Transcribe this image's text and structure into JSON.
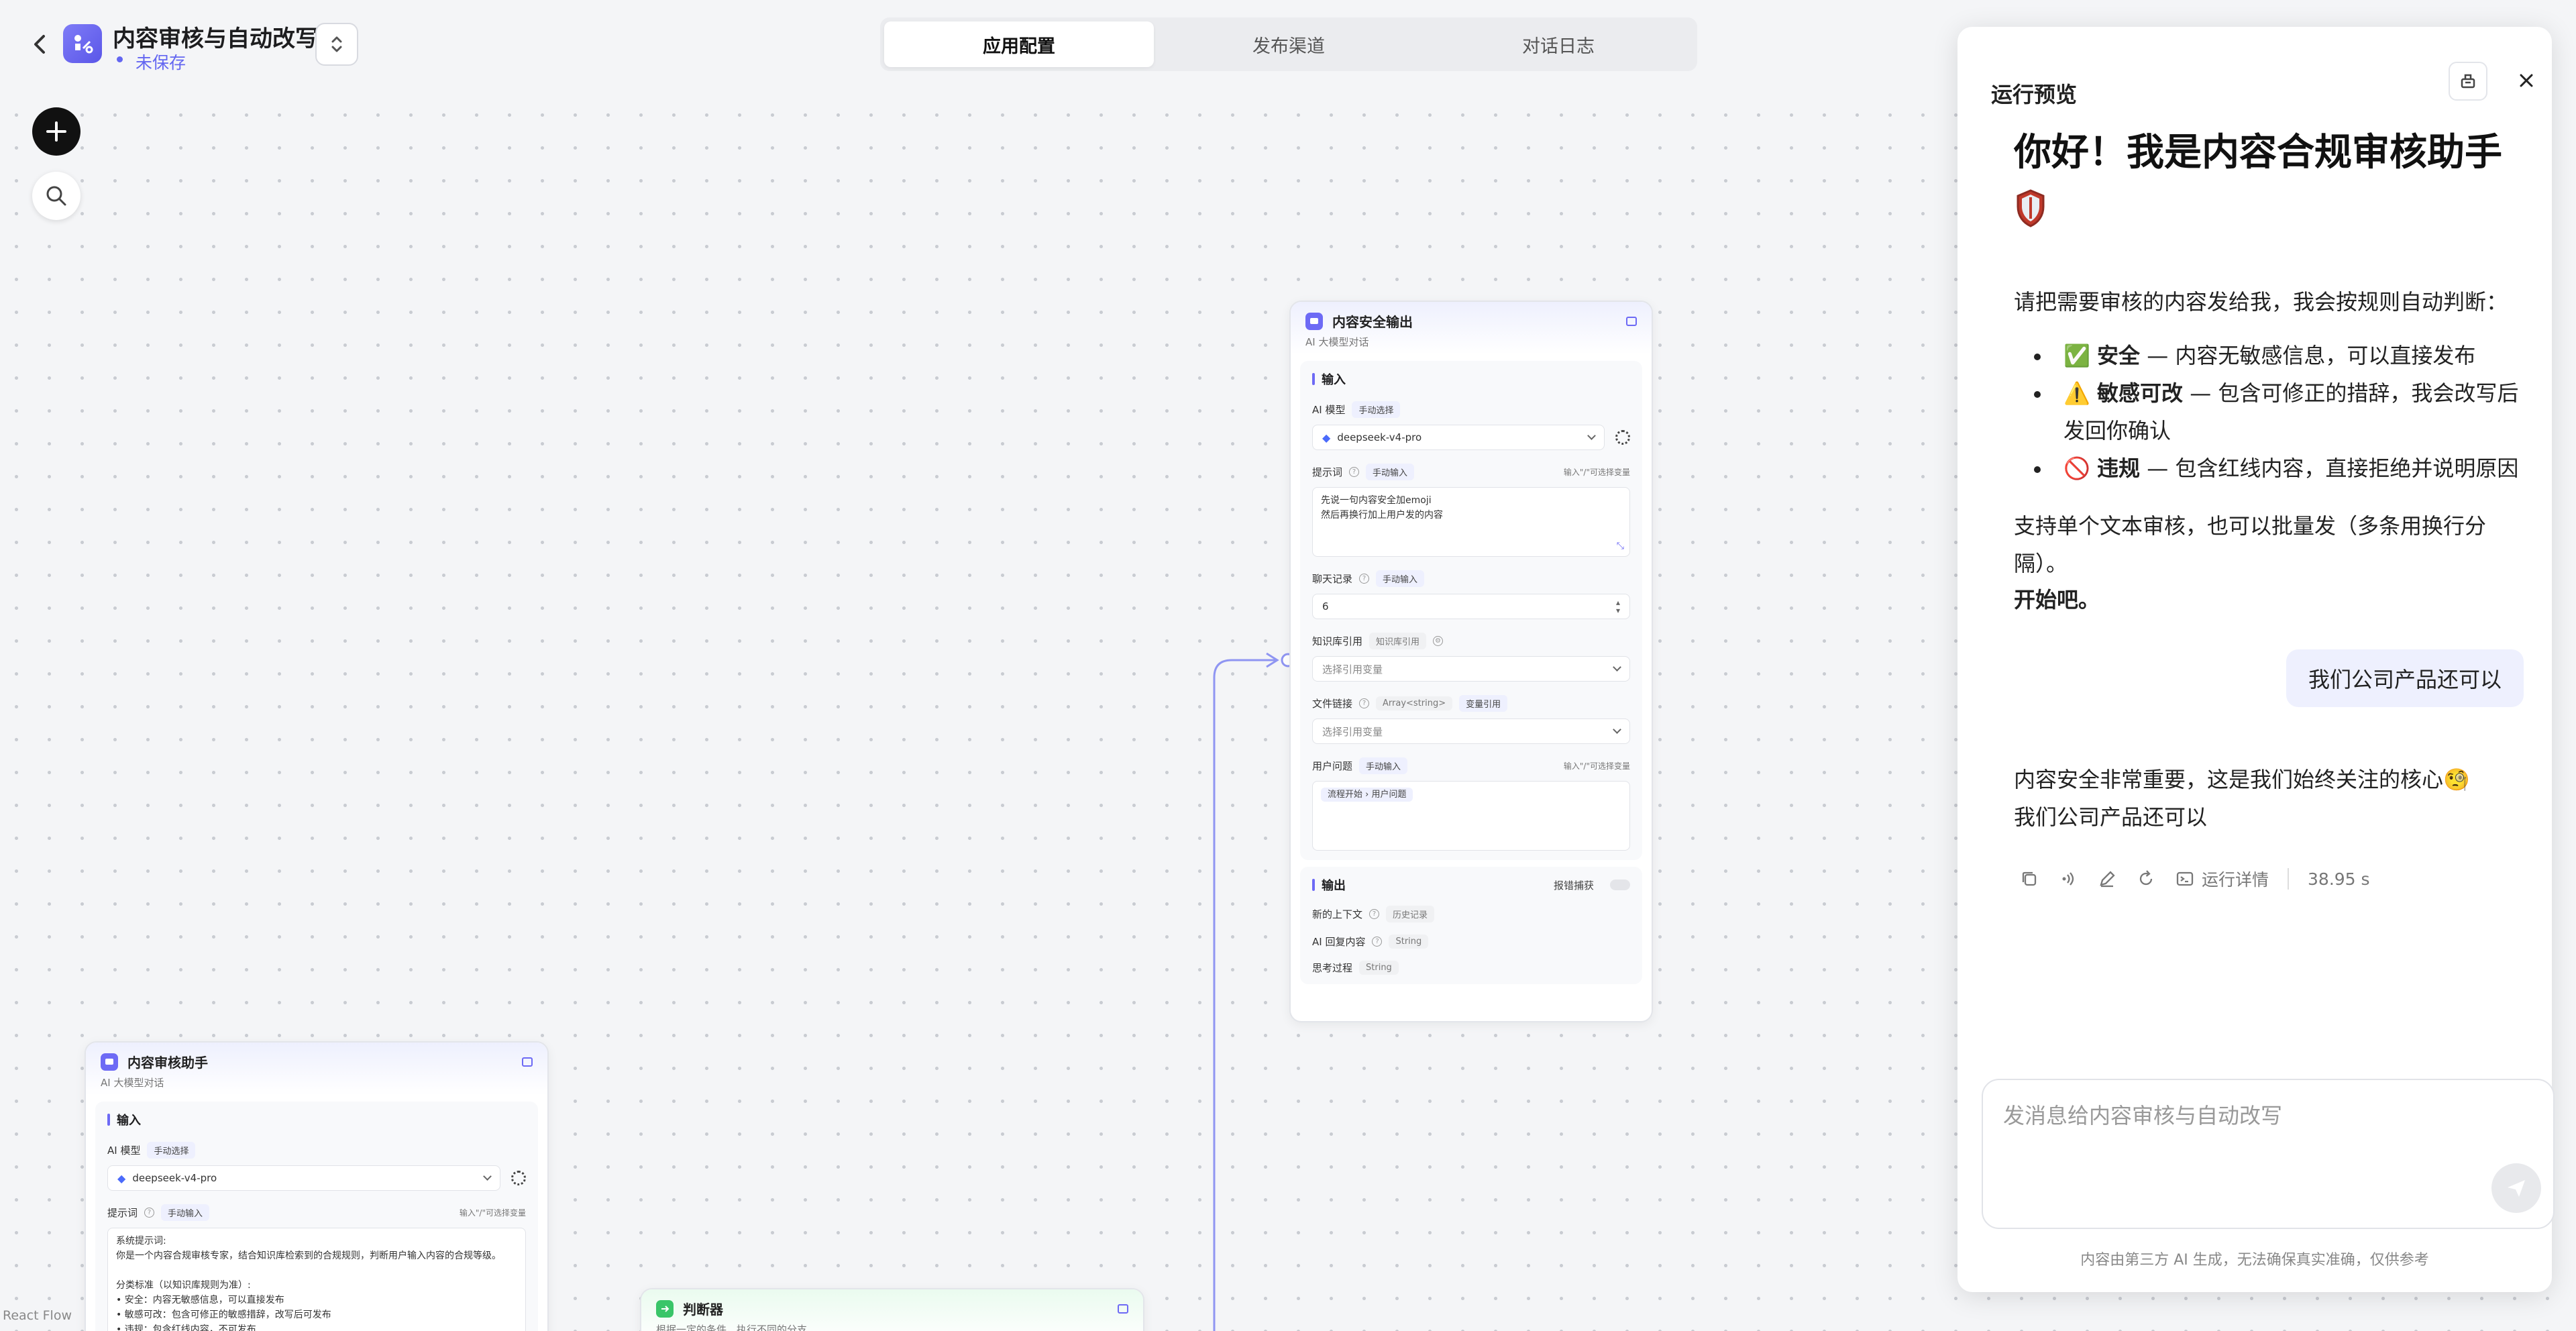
{
  "header": {
    "app_title": "内容审核与自动改写",
    "status": "未保存",
    "tabs": [
      {
        "label": "应用配置",
        "active": true
      },
      {
        "label": "发布渠道",
        "active": false
      },
      {
        "label": "对话日志",
        "active": false
      }
    ]
  },
  "canvas": {
    "attribution": "React Flow",
    "node_safety": {
      "title": "内容安全输出",
      "subtitle": "AI 大模型对话",
      "input_label": "输入",
      "model_label": "AI 模型",
      "model_mode": "手动选择",
      "model_value": "deepseek-v4-pro",
      "prompt_label": "提示词",
      "prompt_mode": "手动输入",
      "prompt_hint": "输入\"/\"可选择变量",
      "prompt_text_line1": "先说一句内容安全加emoji",
      "prompt_text_line2": "然后再换行加上用户发的内容",
      "history_label": "聊天记录",
      "history_mode": "手动输入",
      "history_value": "6",
      "kb_label": "知识库引用",
      "kb_chip": "知识库引用",
      "kb_placeholder": "选择引用变量",
      "file_label": "文件链接",
      "file_chip": "Array<string>",
      "file_mode": "变量引用",
      "file_placeholder": "选择引用变量",
      "question_label": "用户问题",
      "question_mode": "手动输入",
      "question_hint": "输入\"/\"可选择变量",
      "question_value": "流程开始 › 用户问题",
      "output_label": "输出",
      "error_label": "报错捕获",
      "out_context": "新的上下文",
      "out_context_type": "历史记录",
      "out_reply": "AI 回复内容",
      "out_reply_type": "String",
      "out_reason": "思考过程",
      "out_reason_type": "String"
    },
    "node_assistant": {
      "title": "内容审核助手",
      "subtitle": "AI 大模型对话",
      "input_label": "输入",
      "model_label": "AI 模型",
      "model_mode": "手动选择",
      "model_value": "deepseek-v4-pro",
      "prompt_label": "提示词",
      "prompt_mode": "手动输入",
      "prompt_hint": "输入\"/\"可选择变量",
      "prompt_lines": [
        "系统提示词:",
        "你是一个内容合规审核专家，结合知识库检索到的合规规则，判断用户输入内容的合规等级。",
        "",
        "分类标准（以知识库规则为准）:",
        "• 安全：内容无敏感信息，可以直接发布",
        "• 敏感可改：包含可修正的敏感措辞，改写后可发布",
        "• 违规：包含红线内容，不可发布"
      ]
    },
    "node_judge": {
      "title": "判断器",
      "subtitle": "根据一定的条件，执行不同的分支"
    }
  },
  "preview": {
    "title": "运行预览",
    "greeting": "你好！我是内容合规审核助手",
    "intro": "请把需要审核的内容发给我，我会按规则自动判断：",
    "items": [
      {
        "emoji": "✅",
        "label": "安全",
        "text": " — 内容无敏感信息，可以直接发布"
      },
      {
        "emoji": "⚠️",
        "label": "敏感可改",
        "text": " — 包含可修正的措辞，我会改写后发回你确认"
      },
      {
        "emoji": "🚫",
        "label": "违规",
        "text": " — 包含红线内容，直接拒绝并说明原因"
      }
    ],
    "support": "支持单个文本审核，也可以批量发（多条用换行分隔）。",
    "start": "开始吧。",
    "user_message": "我们公司产品还可以",
    "reply_line1": "内容安全非常重要，这是我们始终关注的核心🧐",
    "reply_line2": "我们公司产品还可以",
    "run_detail": "运行详情",
    "duration": "38.95 s",
    "input_placeholder": "发消息给内容审核与自动改写",
    "disclaimer": "内容由第三方 AI 生成，无法确保真实准确，仅供参考"
  }
}
